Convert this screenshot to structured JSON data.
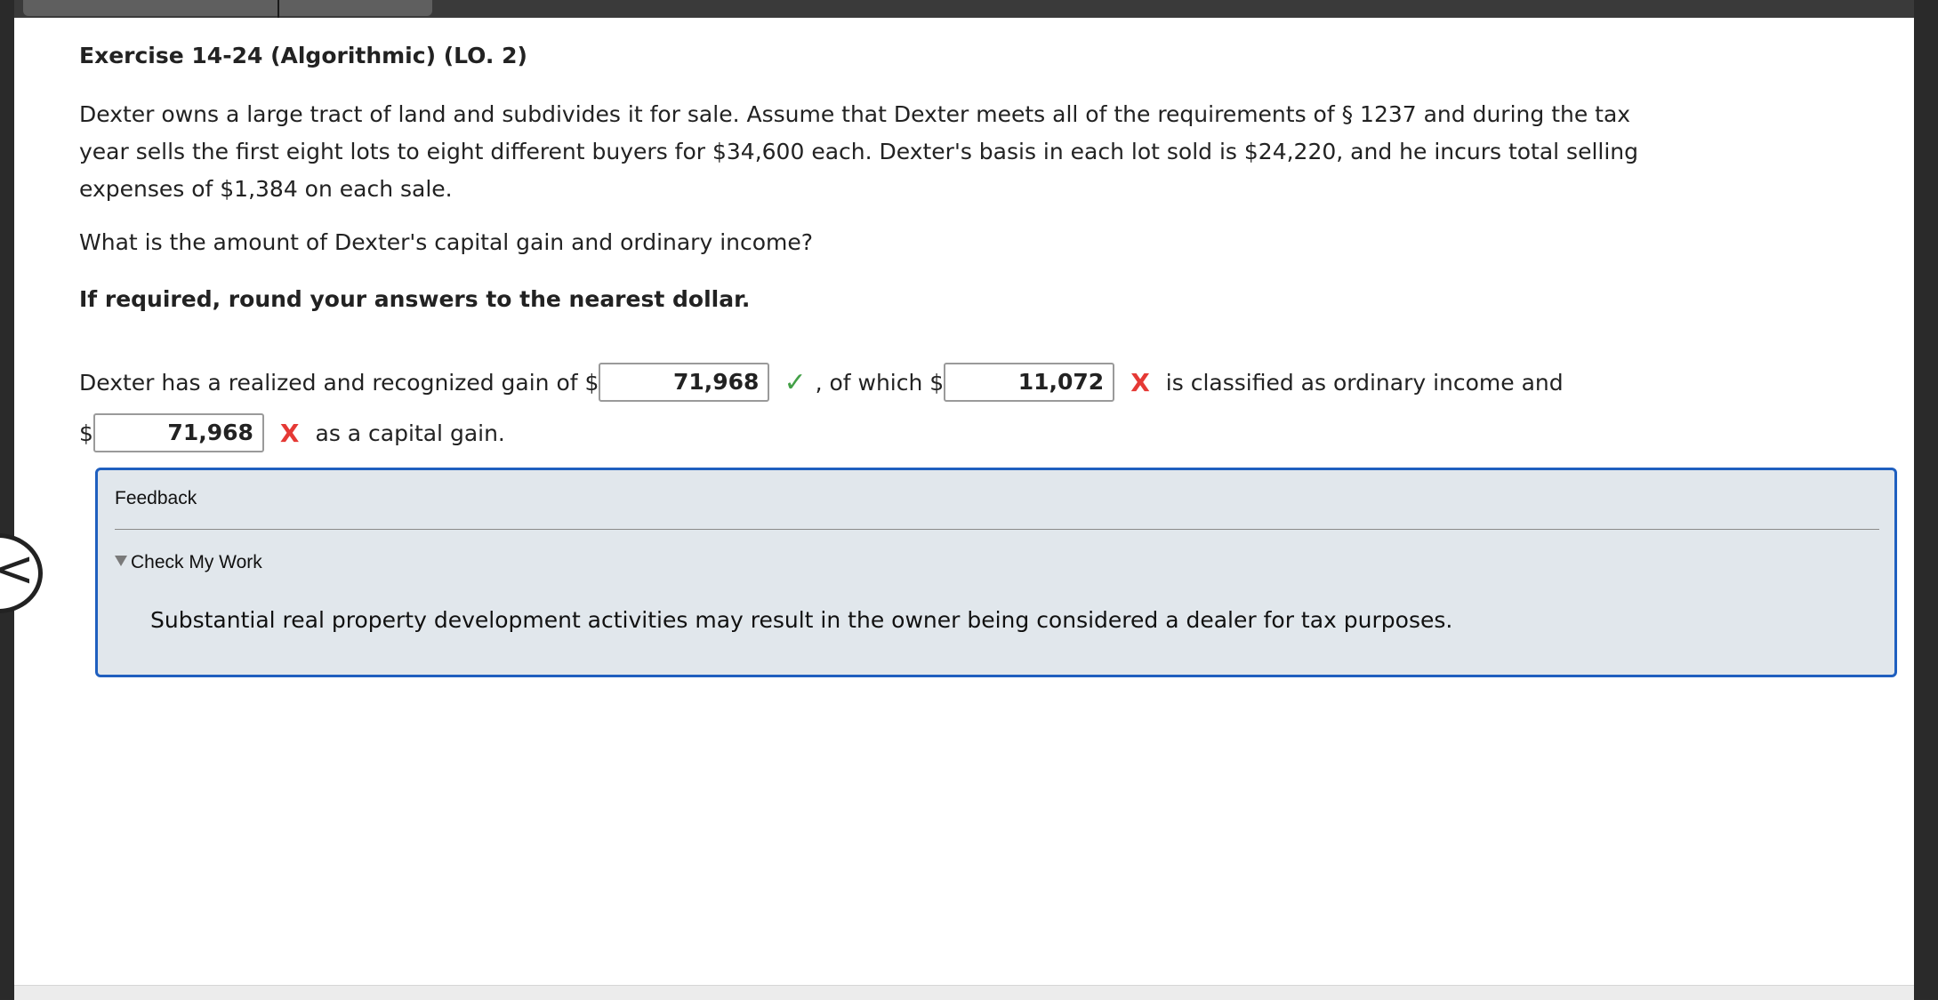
{
  "exercise": {
    "title": "Exercise 14-24 (Algorithmic) (LO. 2)",
    "paragraph_lines": [
      "Dexter owns a large tract of land and subdivides it for sale. Assume that Dexter meets all of the requirements of § 1237 and during the tax",
      "year sells the first eight lots to eight different buyers for $34,600 each. Dexter's basis in each lot sold is $24,220, and he incurs total selling",
      "expenses of $1,384 on each sale."
    ],
    "question": "What is the amount of Dexter's capital gain and ordinary income?",
    "instruction": "If required, round your answers to the nearest dollar."
  },
  "answer": {
    "line1_prefix": "Dexter has a realized and recognized gain of $",
    "field1_value": "71,968",
    "field1_status": "correct",
    "line1_middle": ", of which $",
    "field2_value": "11,072",
    "field2_status": "incorrect",
    "line1_suffix": "is classified as ordinary income and",
    "line2_prefix": "$",
    "field3_value": "71,968",
    "field3_status": "incorrect",
    "line2_suffix": "as a capital gain.",
    "correct_mark": "✓",
    "incorrect_mark": "X"
  },
  "feedback": {
    "label": "Feedback",
    "toggle_label": "Check My Work",
    "message": "Substantial real property development activities may result in the owner being considered a dealer for tax purposes."
  },
  "colors": {
    "correct": "#43a047",
    "incorrect": "#e53935",
    "feedback_border": "#1f5fbf",
    "feedback_bg": "#e1e7ec"
  },
  "icons": {
    "back": "chevron-left-icon",
    "correct": "check-icon",
    "incorrect": "x-icon",
    "toggle": "triangle-down-icon"
  },
  "back_glyph": "<"
}
